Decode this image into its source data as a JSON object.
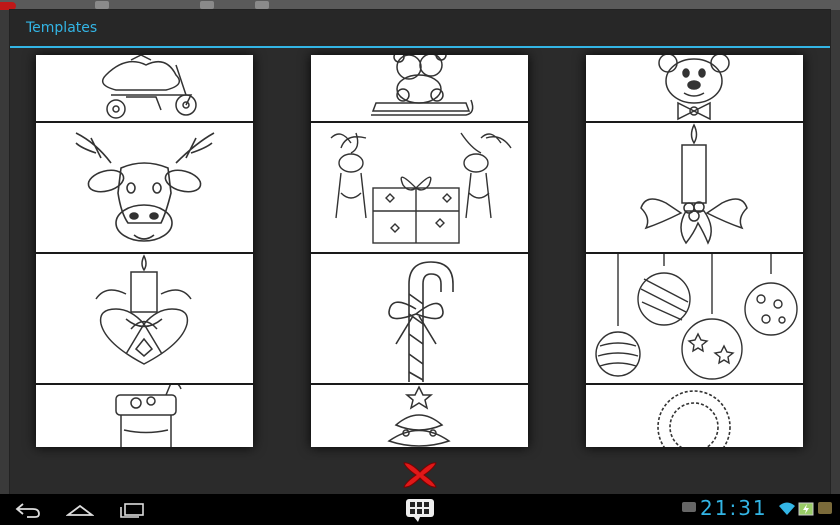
{
  "dialog": {
    "title": "Templates"
  },
  "templates": [
    {
      "name": "tricycle-tree",
      "col": 0,
      "row": 0
    },
    {
      "name": "teddy-on-sled",
      "col": 1,
      "row": 0
    },
    {
      "name": "mouse-bowtie",
      "col": 2,
      "row": 0
    },
    {
      "name": "reindeer-face",
      "col": 0,
      "row": 1
    },
    {
      "name": "reindeer-gift",
      "col": 1,
      "row": 1
    },
    {
      "name": "candle-holly",
      "col": 2,
      "row": 1
    },
    {
      "name": "candle-heart",
      "col": 0,
      "row": 2
    },
    {
      "name": "candy-cane",
      "col": 1,
      "row": 2
    },
    {
      "name": "ornaments",
      "col": 2,
      "row": 2
    },
    {
      "name": "stocking",
      "col": 0,
      "row": 3
    },
    {
      "name": "tree-ornament",
      "col": 1,
      "row": 3
    },
    {
      "name": "wreath",
      "col": 2,
      "row": 3
    }
  ],
  "close_icon_color": "#e01818",
  "accent_color": "#33b5e5",
  "status_bar": {
    "clock": "21:31"
  }
}
